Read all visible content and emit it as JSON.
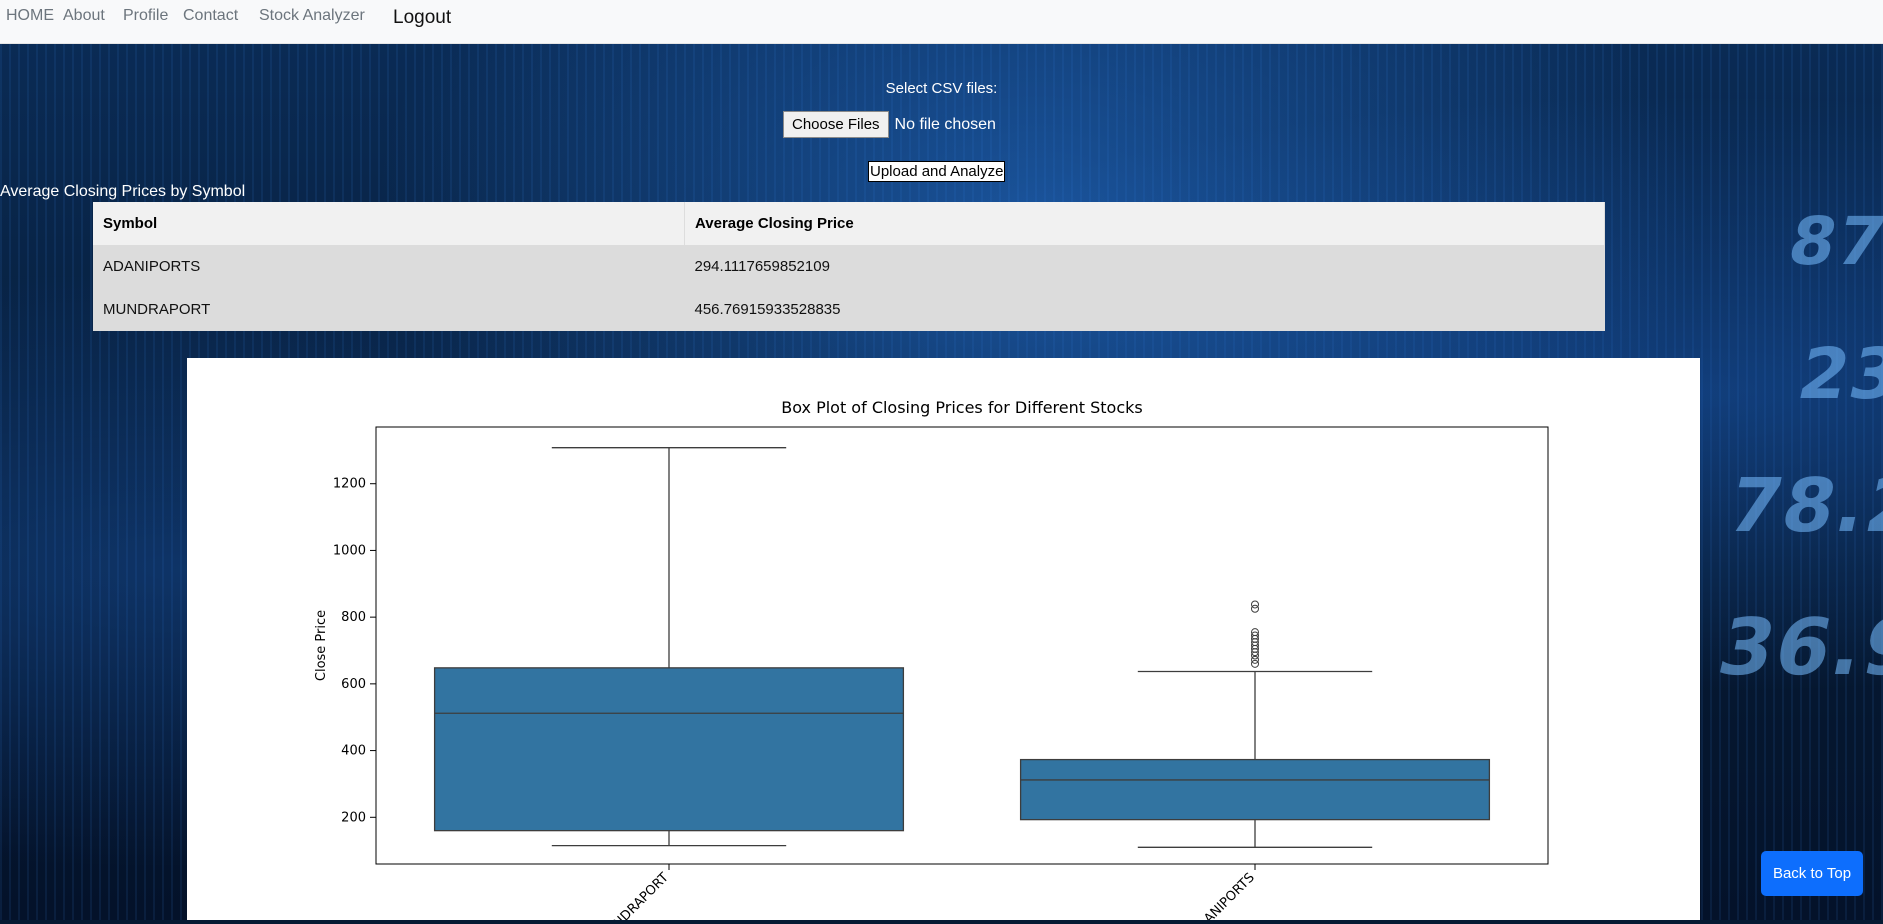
{
  "nav": {
    "items": [
      "HOME",
      "About",
      "Profile",
      "Contact",
      "Stock Analyzer"
    ],
    "logout": "Logout"
  },
  "upload": {
    "select_label": "Select CSV files:",
    "choose_button": "Choose Files",
    "no_file": "No file chosen",
    "analyze_button": "Upload and Analyze"
  },
  "table": {
    "title": "Average Closing Prices by Symbol",
    "headers": [
      "Symbol",
      "Average Closing Price"
    ],
    "rows": [
      [
        "ADANIPORTS",
        "294.1117659852109"
      ],
      [
        "MUNDRAPORT",
        "456.76915933528835"
      ]
    ]
  },
  "background_numbers": [
    "87",
    "23.",
    "78.2",
    "36.9"
  ],
  "back_to_top": "Back to Top",
  "colors": {
    "box_fill": "#3274a1",
    "accent_button": "#0d6efd"
  },
  "chart_data": {
    "type": "box",
    "title": "Box Plot of Closing Prices for Different Stocks",
    "xlabel": "",
    "ylabel": "Close Price",
    "ylim": [
      60,
      1370
    ],
    "yticks": [
      200,
      400,
      600,
      800,
      1000,
      1200
    ],
    "categories": [
      "MUNDRAPORT",
      "ADANIPORTS"
    ],
    "tick_labels_visible": [
      "NDRAPORT",
      "ANIPORTS"
    ],
    "boxes": [
      {
        "category": "MUNDRAPORT",
        "whisker_low": 115,
        "q1": 160,
        "median": 512,
        "q3": 648,
        "whisker_high": 1308,
        "outliers": []
      },
      {
        "category": "ADANIPORTS",
        "whisker_low": 110,
        "q1": 193,
        "median": 312,
        "q3": 373,
        "whisker_high": 637,
        "outliers": [
          660,
          672,
          685,
          695,
          705,
          715,
          725,
          735,
          745,
          755,
          825,
          838
        ]
      }
    ]
  }
}
